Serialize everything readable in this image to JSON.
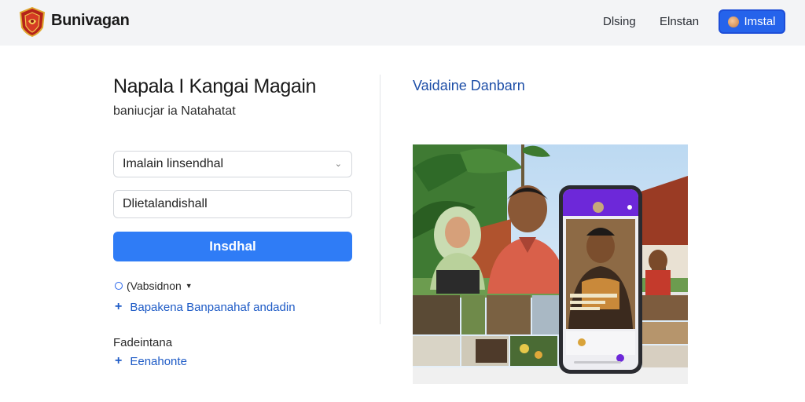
{
  "header": {
    "brand": "Bunivagan",
    "nav": [
      "Dlsing",
      "Elnstan"
    ],
    "cta_label": "Imstal"
  },
  "left": {
    "title": "Napala I Kangai Magain",
    "subtitle": "baniucjar ia Natahatat",
    "select_value": "Imalain linsendhal",
    "input_value": "Dlietalandishall",
    "primary_label": "Insdhal",
    "option_label": "(Vabsidnon",
    "link_1": "Bapakena Banpanahaf andadin",
    "section_label": "Fadeintana",
    "link_2": "Eenahonte"
  },
  "right": {
    "title": "Vaidaine Danbarn"
  },
  "colors": {
    "accent": "#2f7cf6",
    "link": "#1e5bc6",
    "header_bg": "#f3f4f6",
    "phone_purple": "#6d28d9"
  },
  "icons": [
    "crest-logo",
    "avatar-icon",
    "chevron-down-icon",
    "radio-icon",
    "plus-icon",
    "phone-mockup"
  ]
}
